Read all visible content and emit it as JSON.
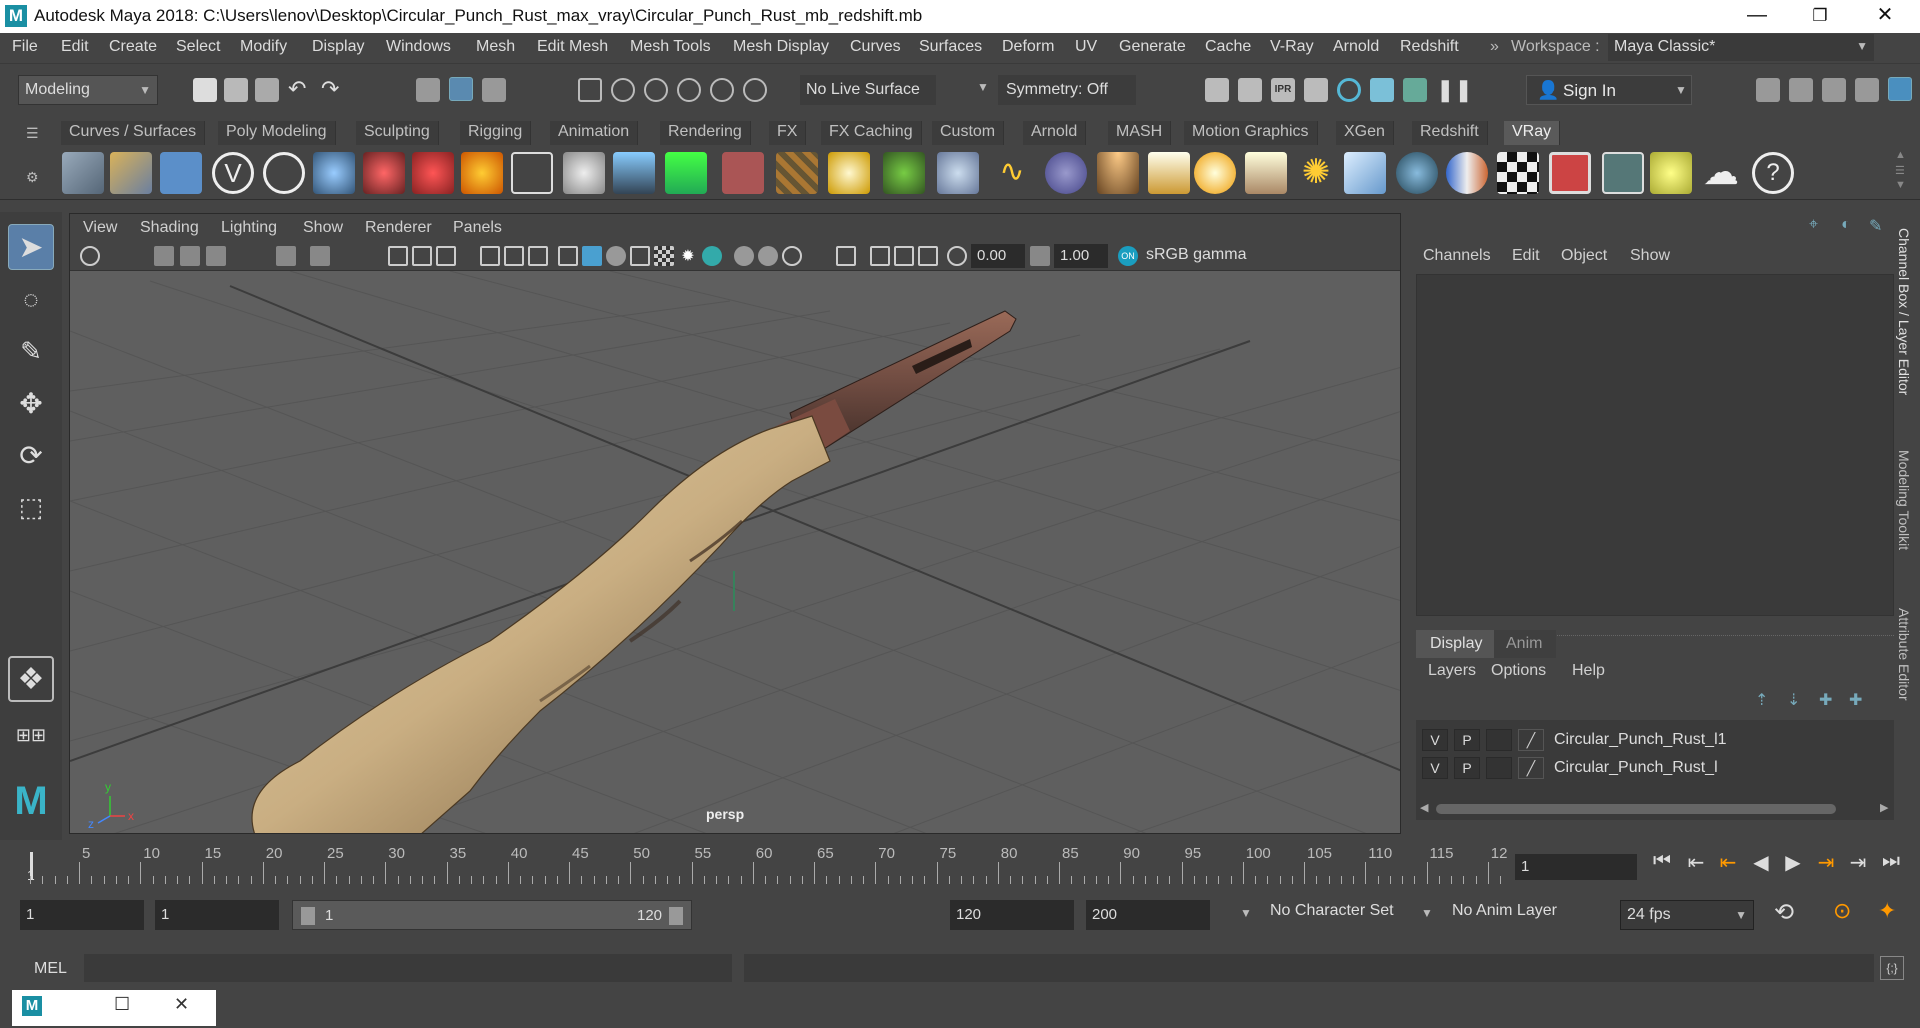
{
  "window": {
    "title": "Autodesk Maya 2018: C:\\Users\\lenov\\Desktop\\Circular_Punch_Rust_max_vray\\Circular_Punch_Rust_mb_redshift.mb",
    "logo": "M",
    "minimize": "—",
    "restore": "❐",
    "close": "✕"
  },
  "menubar": {
    "items": [
      "File",
      "Edit",
      "Create",
      "Select",
      "Modify",
      "Display",
      "Windows",
      "Mesh",
      "Edit Mesh",
      "Mesh Tools",
      "Mesh Display",
      "Curves",
      "Surfaces",
      "Deform",
      "UV",
      "Generate",
      "Cache",
      "V-Ray",
      "Arnold",
      "Redshift"
    ],
    "workspace_label": "Workspace :",
    "workspace_value": "Maya Classic*"
  },
  "statusline": {
    "mode": "Modeling",
    "live_surface": "No Live Surface",
    "symmetry": "Symmetry: Off",
    "sign_in": "Sign In"
  },
  "shelf_tabs": [
    "Curves / Surfaces",
    "Poly Modeling",
    "Sculpting",
    "Rigging",
    "Animation",
    "Rendering",
    "FX",
    "FX Caching",
    "Custom",
    "Arnold",
    "MASH",
    "Motion Graphics",
    "XGen",
    "Redshift",
    "VRay"
  ],
  "active_shelf_tab": "VRay",
  "viewport": {
    "menu": [
      "View",
      "Shading",
      "Lighting",
      "Show",
      "Renderer",
      "Panels"
    ],
    "exposure": "0.00",
    "gamma": "1.00",
    "color_space": "sRGB gamma",
    "camera_label": "persp"
  },
  "channel_box": {
    "menu": [
      "Channels",
      "Edit",
      "Object",
      "Show"
    ]
  },
  "layer_editor": {
    "tabs": [
      "Display",
      "Anim"
    ],
    "menu": [
      "Layers",
      "Options",
      "Help"
    ],
    "layers": [
      {
        "v": "V",
        "p": "P",
        "name": "Circular_Punch_Rust_l1"
      },
      {
        "v": "V",
        "p": "P",
        "name": "Circular_Punch_Rust_l"
      }
    ]
  },
  "side_tabs": [
    "Channel Box / Layer Editor",
    "Modeling Toolkit",
    "Attribute Editor"
  ],
  "timeline": {
    "ticks": [
      "5",
      "10",
      "15",
      "20",
      "25",
      "30",
      "35",
      "40",
      "45",
      "50",
      "55",
      "60",
      "65",
      "70",
      "75",
      "80",
      "85",
      "90",
      "95",
      "100",
      "105",
      "110",
      "115",
      "12"
    ],
    "start_marker": "1",
    "current_frame": "1"
  },
  "range": {
    "start": "1",
    "playback_start": "1",
    "slider_start": "1",
    "slider_end": "120",
    "playback_end": "120",
    "end": "200",
    "character_set": "No Character Set",
    "anim_layer": "No Anim Layer",
    "fps": "24 fps"
  },
  "command_line": {
    "label": "MEL"
  }
}
